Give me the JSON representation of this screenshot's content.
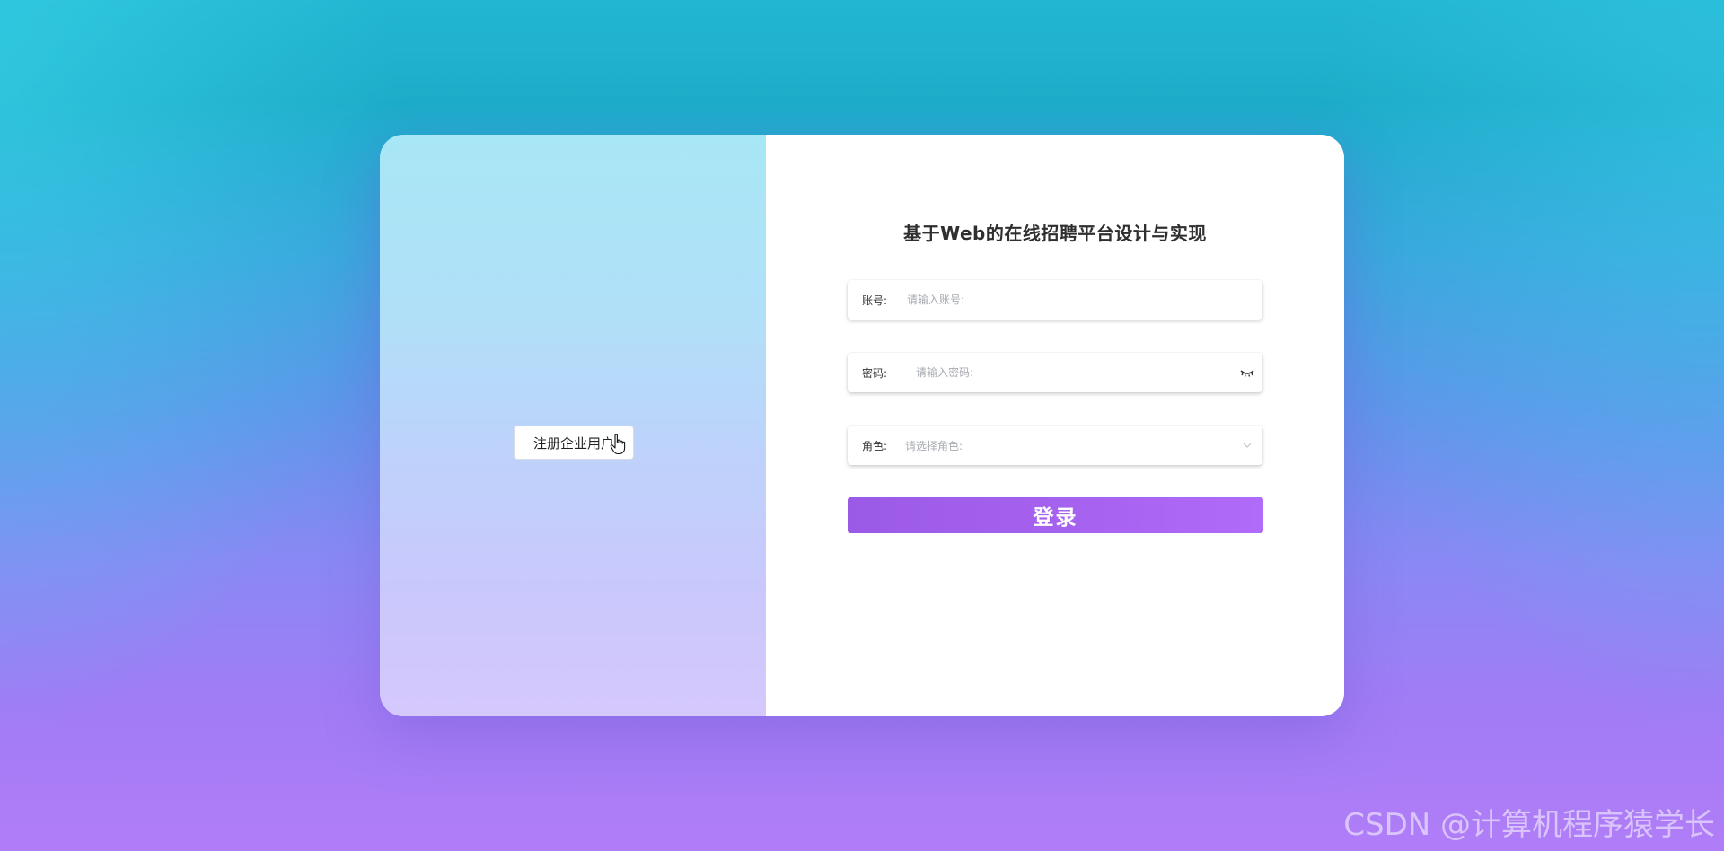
{
  "login": {
    "title": "基于Web的在线招聘平台设计与实现",
    "account_label": "账号:",
    "account_placeholder": "请输入账号:",
    "password_label": "密码:",
    "password_placeholder": "请输入密码:",
    "role_label": "角色:",
    "role_placeholder": "请选择角色:",
    "submit_label": "登录"
  },
  "left_panel": {
    "register_label": "注册企业用户"
  },
  "icons": {
    "password_toggle": "eye-closed-icon",
    "role_dropdown": "chevron-down-icon",
    "cursor": "hand-pointer-icon"
  },
  "colors": {
    "accent": "#a763f0",
    "card_left_top": "#a8e7f5",
    "card_left_bottom": "#d5c8fd"
  },
  "watermark": "CSDN @计算机程序猿学长"
}
